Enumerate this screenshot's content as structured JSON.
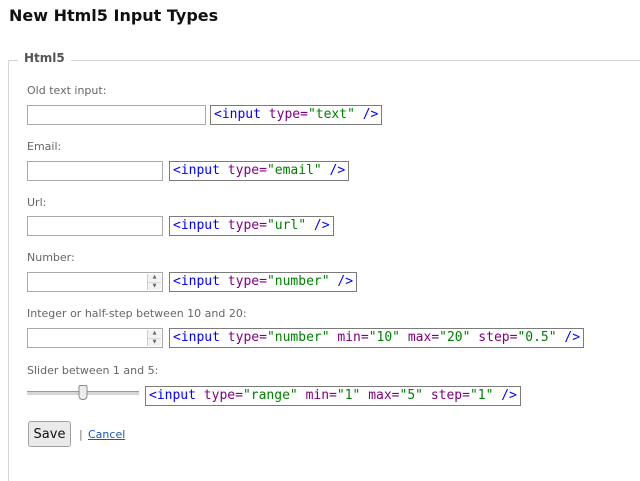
{
  "page_title": "New Html5 Input Types",
  "fieldset_legend": "Html5",
  "fields": [
    {
      "label": "Old text input:",
      "code": {
        "open": "<input ",
        "type_attr": "type=",
        "type_value": "\"text\"",
        "extra": [],
        "close": " />"
      }
    },
    {
      "label": "Email:",
      "code": {
        "open": "<input ",
        "type_attr": "type=",
        "type_value": "\"email\"",
        "extra": [],
        "close": " />"
      }
    },
    {
      "label": "Url:",
      "code": {
        "open": "<input ",
        "type_attr": "type=",
        "type_value": "\"url\"",
        "extra": [],
        "close": " />"
      }
    },
    {
      "label": "Number:",
      "code": {
        "open": "<input ",
        "type_attr": "type=",
        "type_value": "\"number\"",
        "extra": [],
        "close": " />"
      }
    },
    {
      "label": "Integer or half-step between 10 and 20:",
      "code": {
        "open": "<input ",
        "type_attr": "type=",
        "type_value": "\"number\"",
        "extra": [
          {
            "attr": "min=",
            "value": "\"10\""
          },
          {
            "attr": "max=",
            "value": "\"20\""
          },
          {
            "attr": "step=",
            "value": "\"0.5\""
          }
        ],
        "close": " />"
      }
    },
    {
      "label": "Slider between 1 and 5:",
      "code": {
        "open": "<input ",
        "type_attr": "type=",
        "type_value": "\"range\"",
        "extra": [
          {
            "attr": "min=",
            "value": "\"1\""
          },
          {
            "attr": "max=",
            "value": "\"5\""
          },
          {
            "attr": "step=",
            "value": "\"1\""
          }
        ],
        "close": " />"
      }
    }
  ],
  "slider": {
    "min": 1,
    "max": 5,
    "value": 3
  },
  "actions": {
    "save_label": "Save",
    "separator": "|",
    "cancel_label": "Cancel"
  },
  "colors": {
    "code_punct": "#0000ff",
    "code_attr": "#800080",
    "code_value": "#008000",
    "link": "#1a57b6"
  }
}
